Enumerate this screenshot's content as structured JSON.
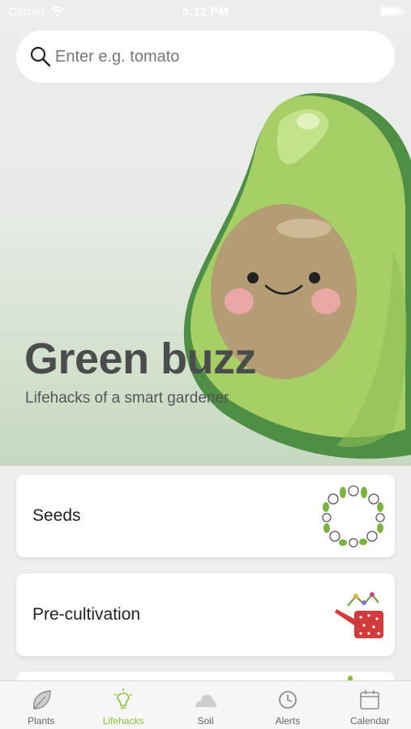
{
  "status_bar": {
    "carrier": "Carrier",
    "time": "5:12 PM"
  },
  "search": {
    "placeholder": "Enter e.g. tomato"
  },
  "hero": {
    "title": "Green buzz",
    "subtitle": "Lifehacks of a smart gardener"
  },
  "cards": [
    {
      "label": "Seeds",
      "icon": "vegetable-wreath-icon"
    },
    {
      "label": "Pre-cultivation",
      "icon": "watering-can-icon"
    },
    {
      "label": "",
      "icon": "plant-icon"
    }
  ],
  "tabs": [
    {
      "label": "Plants",
      "icon": "leaf-icon",
      "active": false
    },
    {
      "label": "Lifehacks",
      "icon": "lightbulb-icon",
      "active": true
    },
    {
      "label": "Soil",
      "icon": "soil-mound-icon",
      "active": false
    },
    {
      "label": "Alerts",
      "icon": "clock-icon",
      "active": false
    },
    {
      "label": "Calendar",
      "icon": "calendar-icon",
      "active": false
    }
  ],
  "colors": {
    "accent": "#8bbf3c",
    "avocado_skin": "#4e8a44",
    "avocado_flesh": "#a9d16a",
    "avocado_pit": "#b89f78"
  }
}
